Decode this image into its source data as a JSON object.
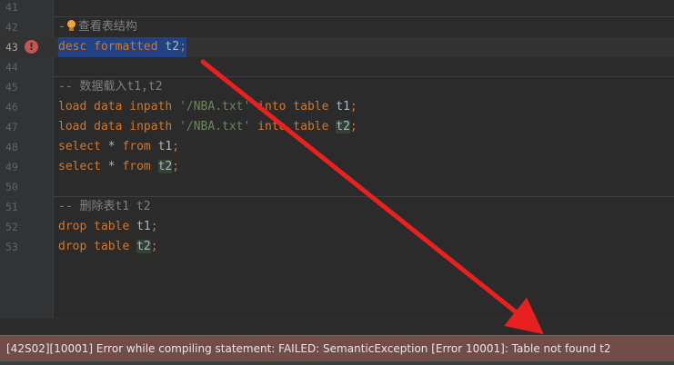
{
  "editor": {
    "lines": [
      {
        "num": "41"
      },
      {
        "num": "42",
        "comment_prefix": "-",
        "comment_text": "查看表结构"
      },
      {
        "num": "43",
        "t1": "desc",
        "t2": " formatted ",
        "t3": "t2",
        "t4": ";"
      },
      {
        "num": "44"
      },
      {
        "num": "45",
        "comment": "-- 数据载入t1,t2"
      },
      {
        "num": "46",
        "t1": "load data inpath ",
        "t2": "'/NBA.txt'",
        "t3": " into table ",
        "t4": "t1",
        "t5": ";"
      },
      {
        "num": "47",
        "t1": "load data inpath ",
        "t2": "'/NBA.txt'",
        "t3": " into table ",
        "t4": "t2",
        "t5": ";"
      },
      {
        "num": "48",
        "t1": "select ",
        "t2": "*",
        "t3": " from ",
        "t4": "t1",
        "t5": ";"
      },
      {
        "num": "49",
        "t1": "select ",
        "t2": "*",
        "t3": " from ",
        "t4": "t2",
        "t5": ";"
      },
      {
        "num": "50"
      },
      {
        "num": "51",
        "comment": "-- 删除表t1 t2"
      },
      {
        "num": "52",
        "t1": "drop table ",
        "t2": "t1",
        "t3": ";"
      },
      {
        "num": "53",
        "t1": "drop table ",
        "t2": "t2",
        "t3": ";"
      }
    ],
    "error_icon": "!"
  },
  "status": {
    "message": "[42S02][10001] Error while compiling statement: FAILED: SemanticException [Error 10001]: Table not found t2"
  },
  "colors": {
    "keyword": "#cc7832",
    "string": "#6a8759",
    "comment": "#808080",
    "selection": "#214283",
    "error_bar": "#714c48",
    "arrow": "#e8201f"
  },
  "icons": [
    "error-icon",
    "lightbulb-icon",
    "red-arrow-annotation"
  ]
}
